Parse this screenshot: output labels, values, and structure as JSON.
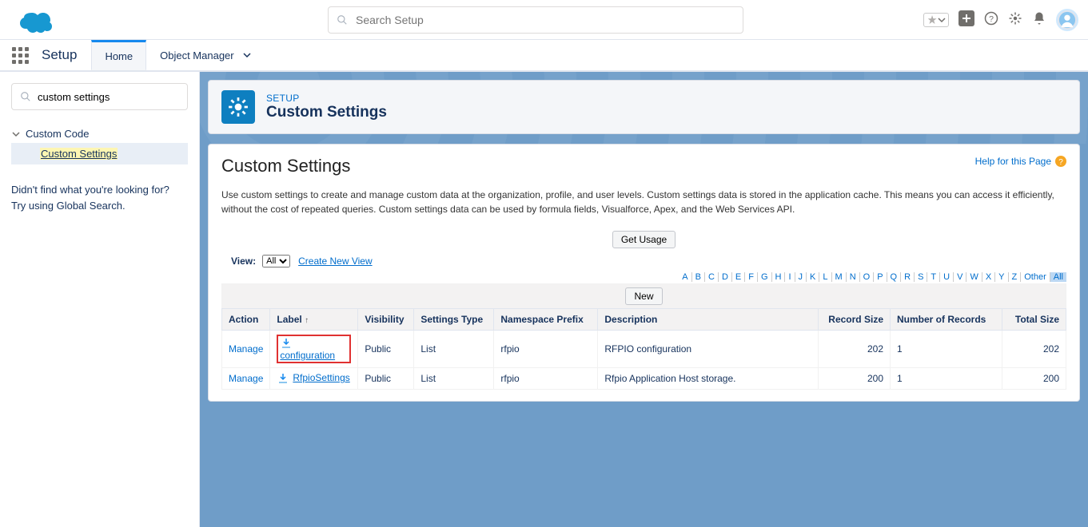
{
  "top": {
    "search_placeholder": "Search Setup"
  },
  "nav": {
    "app_title": "Setup",
    "tabs": [
      {
        "label": "Home",
        "active": true
      },
      {
        "label": "Object Manager",
        "active": false
      }
    ]
  },
  "sidebar": {
    "search_value": "custom settings",
    "tree_parent": "Custom Code",
    "tree_child": "Custom Settings",
    "hint_line1": "Didn't find what you're looking for?",
    "hint_line2": "Try using Global Search."
  },
  "header": {
    "eyebrow": "SETUP",
    "title": "Custom Settings"
  },
  "panel": {
    "help": "Help for this Page",
    "title": "Custom Settings",
    "desc": "Use custom settings to create and manage custom data at the organization, profile, and user levels. Custom settings data is stored in the application cache. This means you can access it efficiently, without the cost of repeated queries. Custom settings data can be used by formula fields, Visualforce, Apex, and the Web Services API.",
    "get_usage": "Get Usage",
    "view_label": "View:",
    "view_value": "All",
    "create_view": "Create New View",
    "new_btn": "New",
    "alpha": [
      "A",
      "B",
      "C",
      "D",
      "E",
      "F",
      "G",
      "H",
      "I",
      "J",
      "K",
      "L",
      "M",
      "N",
      "O",
      "P",
      "Q",
      "R",
      "S",
      "T",
      "U",
      "V",
      "W",
      "X",
      "Y",
      "Z",
      "Other",
      "All"
    ],
    "active_alpha": "All"
  },
  "table": {
    "cols": {
      "action": "Action",
      "label": "Label",
      "visibility": "Visibility",
      "settings_type": "Settings Type",
      "namespace": "Namespace Prefix",
      "description": "Description",
      "record_size": "Record Size",
      "num_records": "Number of Records",
      "total_size": "Total Size"
    },
    "manage": "Manage",
    "rows": [
      {
        "label": "configuration",
        "visibility": "Public",
        "settings_type": "List",
        "namespace": "rfpio",
        "description": "RFPIO configuration",
        "record_size": "202",
        "num_records": "1",
        "total_size": "202",
        "highlight": true
      },
      {
        "label": "RfpioSettings",
        "visibility": "Public",
        "settings_type": "List",
        "namespace": "rfpio",
        "description": "Rfpio Application Host storage.",
        "record_size": "200",
        "num_records": "1",
        "total_size": "200",
        "highlight": false
      }
    ]
  }
}
